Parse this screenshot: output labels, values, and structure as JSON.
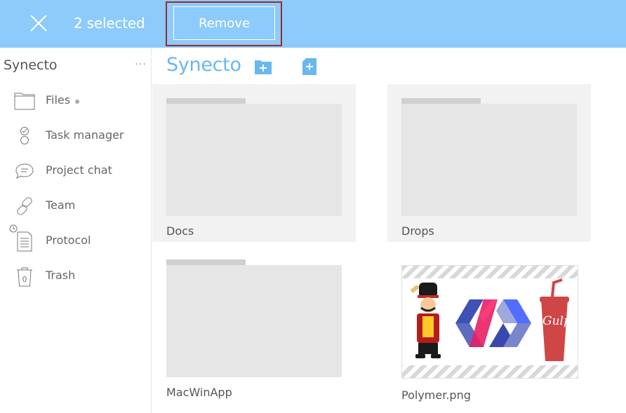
{
  "topbar": {
    "selected_text": "2 selected",
    "remove_label": "Remove",
    "background": "#8ccbfb",
    "highlight_color": "#9e2a2b"
  },
  "sidebar": {
    "title": "Synecto",
    "more": "···",
    "items": [
      {
        "label": "Files",
        "icon": "folder-icon",
        "badge_dot": true
      },
      {
        "label": "Task manager",
        "icon": "task-icon"
      },
      {
        "label": "Project chat",
        "icon": "chat-icon"
      },
      {
        "label": "Team",
        "icon": "link-icon"
      },
      {
        "label": "Protocol",
        "icon": "document-icon"
      },
      {
        "label": "Trash",
        "icon": "trash-icon",
        "count": "0"
      }
    ]
  },
  "main": {
    "title": "Synecto",
    "accent": "#68b8ee",
    "actions": [
      {
        "icon": "new-folder-icon"
      },
      {
        "icon": "new-file-icon"
      }
    ],
    "tiles": [
      {
        "name": "Docs",
        "type": "folder",
        "selected": true
      },
      {
        "name": "Drops",
        "type": "folder",
        "selected": true
      },
      {
        "name": "MacWinApp",
        "type": "folder",
        "selected": false
      },
      {
        "name": "Polymer.png",
        "type": "image",
        "selected": false,
        "depicts": [
          "yeoman-logo",
          "polymer-logo",
          "gulp-logo"
        ]
      }
    ]
  }
}
